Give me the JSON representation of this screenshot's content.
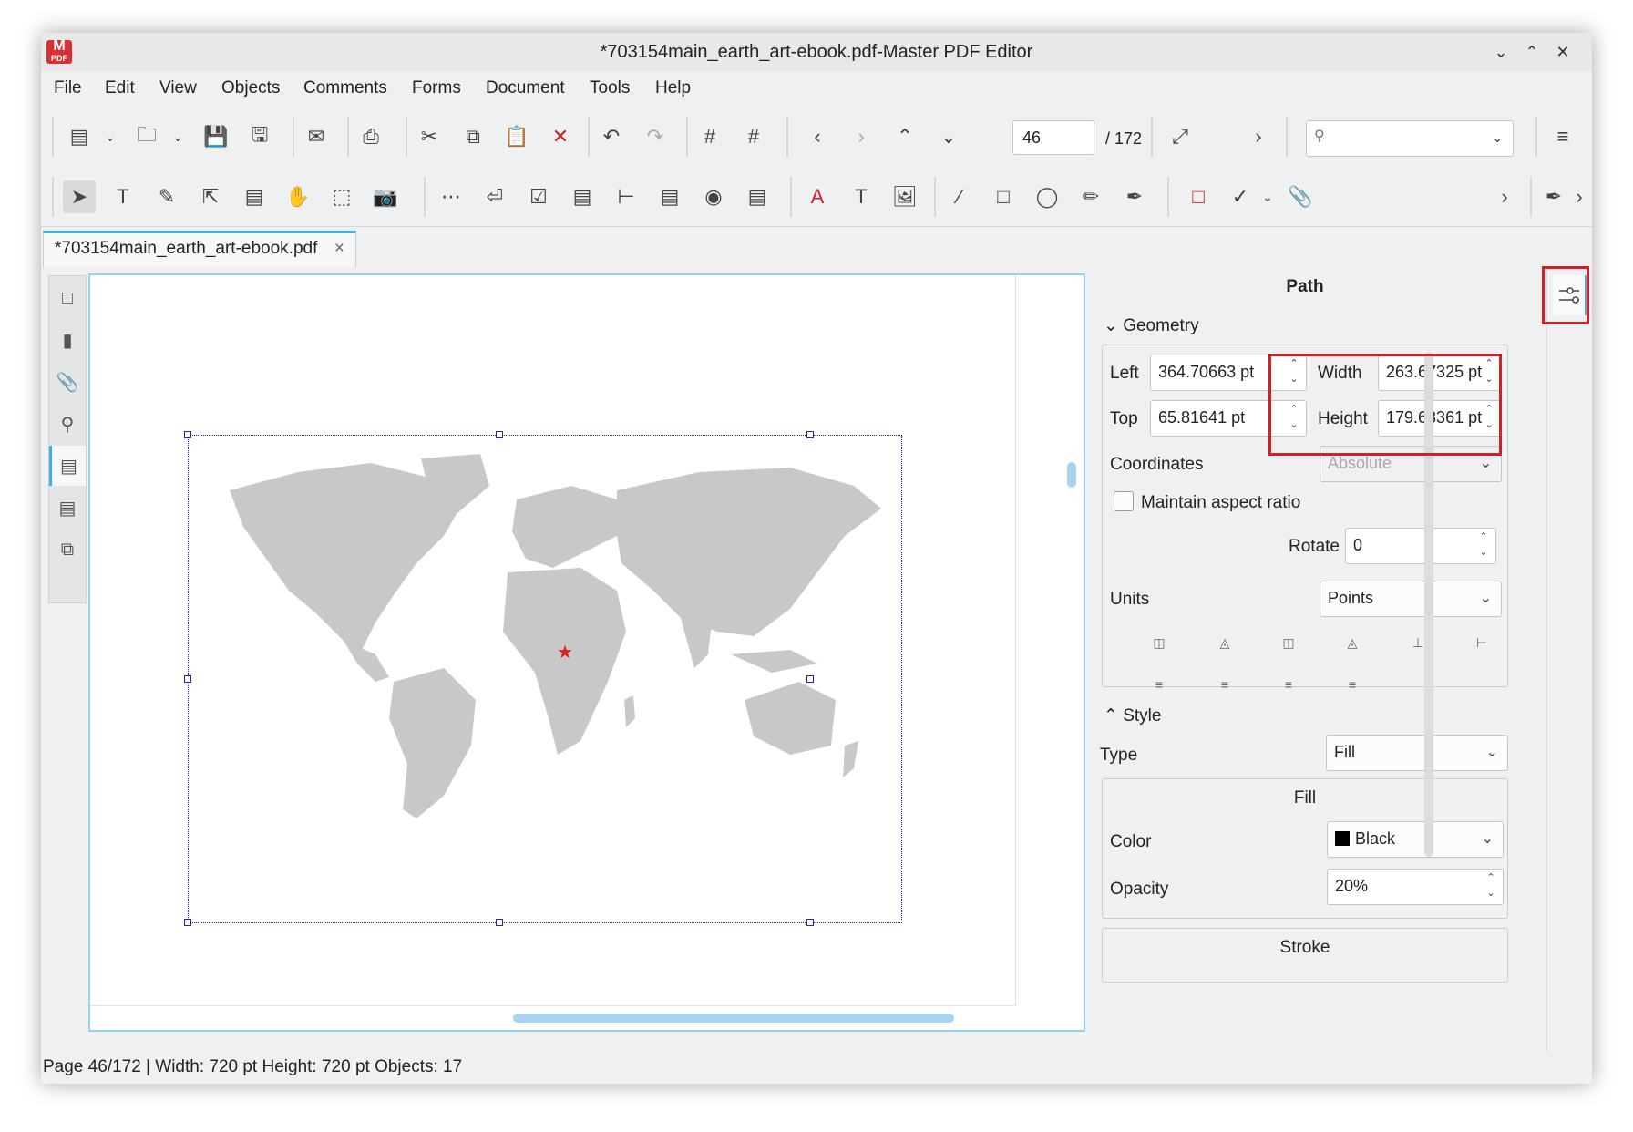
{
  "window": {
    "title": "*703154main_earth_art-ebook.pdf-Master PDF Editor",
    "logo_text": "PDF",
    "controls": [
      "minimize",
      "maximize",
      "close"
    ]
  },
  "menu": [
    "File",
    "Edit",
    "View",
    "Objects",
    "Comments",
    "Forms",
    "Document",
    "Tools",
    "Help"
  ],
  "navigation": {
    "page_value": "46",
    "page_total": "/ 172",
    "search_placeholder": ""
  },
  "document_tab": {
    "label": "*703154main_earth_art-ebook.pdf",
    "close": "×"
  },
  "properties_panel": {
    "title": "Path",
    "geometry": {
      "header": "Geometry",
      "left_label": "Left",
      "left_value": "364.70663 pt",
      "top_label": "Top",
      "top_value": "65.81641 pt",
      "width_label": "Width",
      "width_value": "263.67325 pt",
      "height_label": "Height",
      "height_value": "179.63361 pt",
      "coordinates_label": "Coordinates",
      "coordinates_value": "Absolute",
      "aspect_label": "Maintain aspect ratio",
      "aspect_checked": false,
      "rotate_label": "Rotate",
      "rotate_value": "0",
      "units_label": "Units",
      "units_value": "Points"
    },
    "style": {
      "header": "Style",
      "type_label": "Type",
      "type_value": "Fill",
      "fill_header": "Fill",
      "color_label": "Color",
      "color_value": "Black",
      "color_hex": "#000000",
      "opacity_label": "Opacity",
      "opacity_value": "20%",
      "stroke_header": "Stroke"
    }
  },
  "status_bar": {
    "text": "Page 46/172 | Width: 720 pt Height: 720 pt Objects: 17"
  },
  "colors": {
    "accent": "#3daee9",
    "selection": "#2222cc",
    "highlight": "#d0202a",
    "map_land": "#c8c8c8",
    "marker": "#e02020"
  }
}
